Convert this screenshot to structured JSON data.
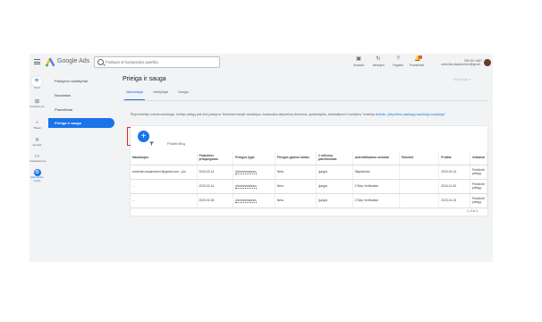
{
  "topbar": {
    "brand": "Google Ads",
    "search_placeholder": "Puslapio ar kampanijos paieška",
    "tools": [
      {
        "icon": "appearance-icon",
        "label": "Išvaizda"
      },
      {
        "icon": "refresh-icon",
        "label": "Atnaujinti"
      },
      {
        "icon": "help-icon",
        "label": "Pagalba"
      },
      {
        "icon": "notifications-icon",
        "label": "Pranešimai",
        "badge": "3"
      }
    ],
    "account_id": "906-261-4667",
    "account_email": "ameshkiv.skapishchevl@gmail..."
  },
  "rail": [
    {
      "icon": "plus-icon",
      "label": "Kurti"
    },
    {
      "icon": "campaigns-icon",
      "label": "Kampani-jos"
    },
    {
      "icon": "goals-icon",
      "label": "Tikslai"
    },
    {
      "icon": "tools-icon",
      "label": "Įrankiai"
    },
    {
      "icon": "billing-icon",
      "label": "Atsiskaitymas"
    },
    {
      "icon": "admin-icon",
      "label": "Administra-vimas"
    }
  ],
  "sidebar": {
    "items": [
      {
        "label": "Paskyros nustatymai"
      },
      {
        "label": "Nuostatos"
      },
      {
        "label": "Pranešimai"
      },
      {
        "label": "Prieiga ir sauga"
      }
    ]
  },
  "main": {
    "title": "Prieiga ir sauga",
    "selector": "Valdytojai",
    "tabs": [
      "Naudotojai",
      "Valdytojai",
      "Sauga"
    ],
    "description": "Šioje lentelėje rodomi naudotojai, turintys prieigą prie šios paskyros. Norėdami valdyti naudotojus, tvarkančius aktyvinimų duomenis, apsilankykite „Atsiskaitymo ir mokėjimų“ lentelėje",
    "description_link": "skirtuke „Aktyvinimo paslaugų naudotojų tvarkytojai“",
    "add_filter": "Pridėti filtrą",
    "pager": "1–3 iš 3"
  },
  "table": {
    "headers": [
      "Naudotojas",
      "Paskutinis prisijungimas",
      "Prieigos lygis",
      "Prieigos gavimo būdas",
      "2 veiksmų patvirtinimas",
      "Autentifikavimo metodai",
      "Pakvietė",
      "Pridėta",
      "Veiksmai"
    ],
    "rows": [
      [
        "ameshkiv.skapishchevl@gmail.com – jūs",
        "2023-02-14",
        "Administratorius",
        "Nėra",
        "Įjungta",
        "Slaptažodis",
        "…",
        "2023-02-14",
        "Peržiūrėti prieigą"
      ],
      [
        "…",
        "2023-02-14",
        "Administratorius",
        "Nėra",
        "Įjungta",
        "2 Step Verification",
        "…",
        "2019-10-30",
        "Peržiūrėti prieigą"
      ],
      [
        "…",
        "2023-02-06",
        "Administratorius",
        "Nėra",
        "Įjungta",
        "2 Step Verification",
        "…",
        "2023-01-19",
        "Peržiūrėti prieigą"
      ]
    ]
  },
  "colors": {
    "accent": "#1a73e8",
    "highlight": "#d93025"
  }
}
